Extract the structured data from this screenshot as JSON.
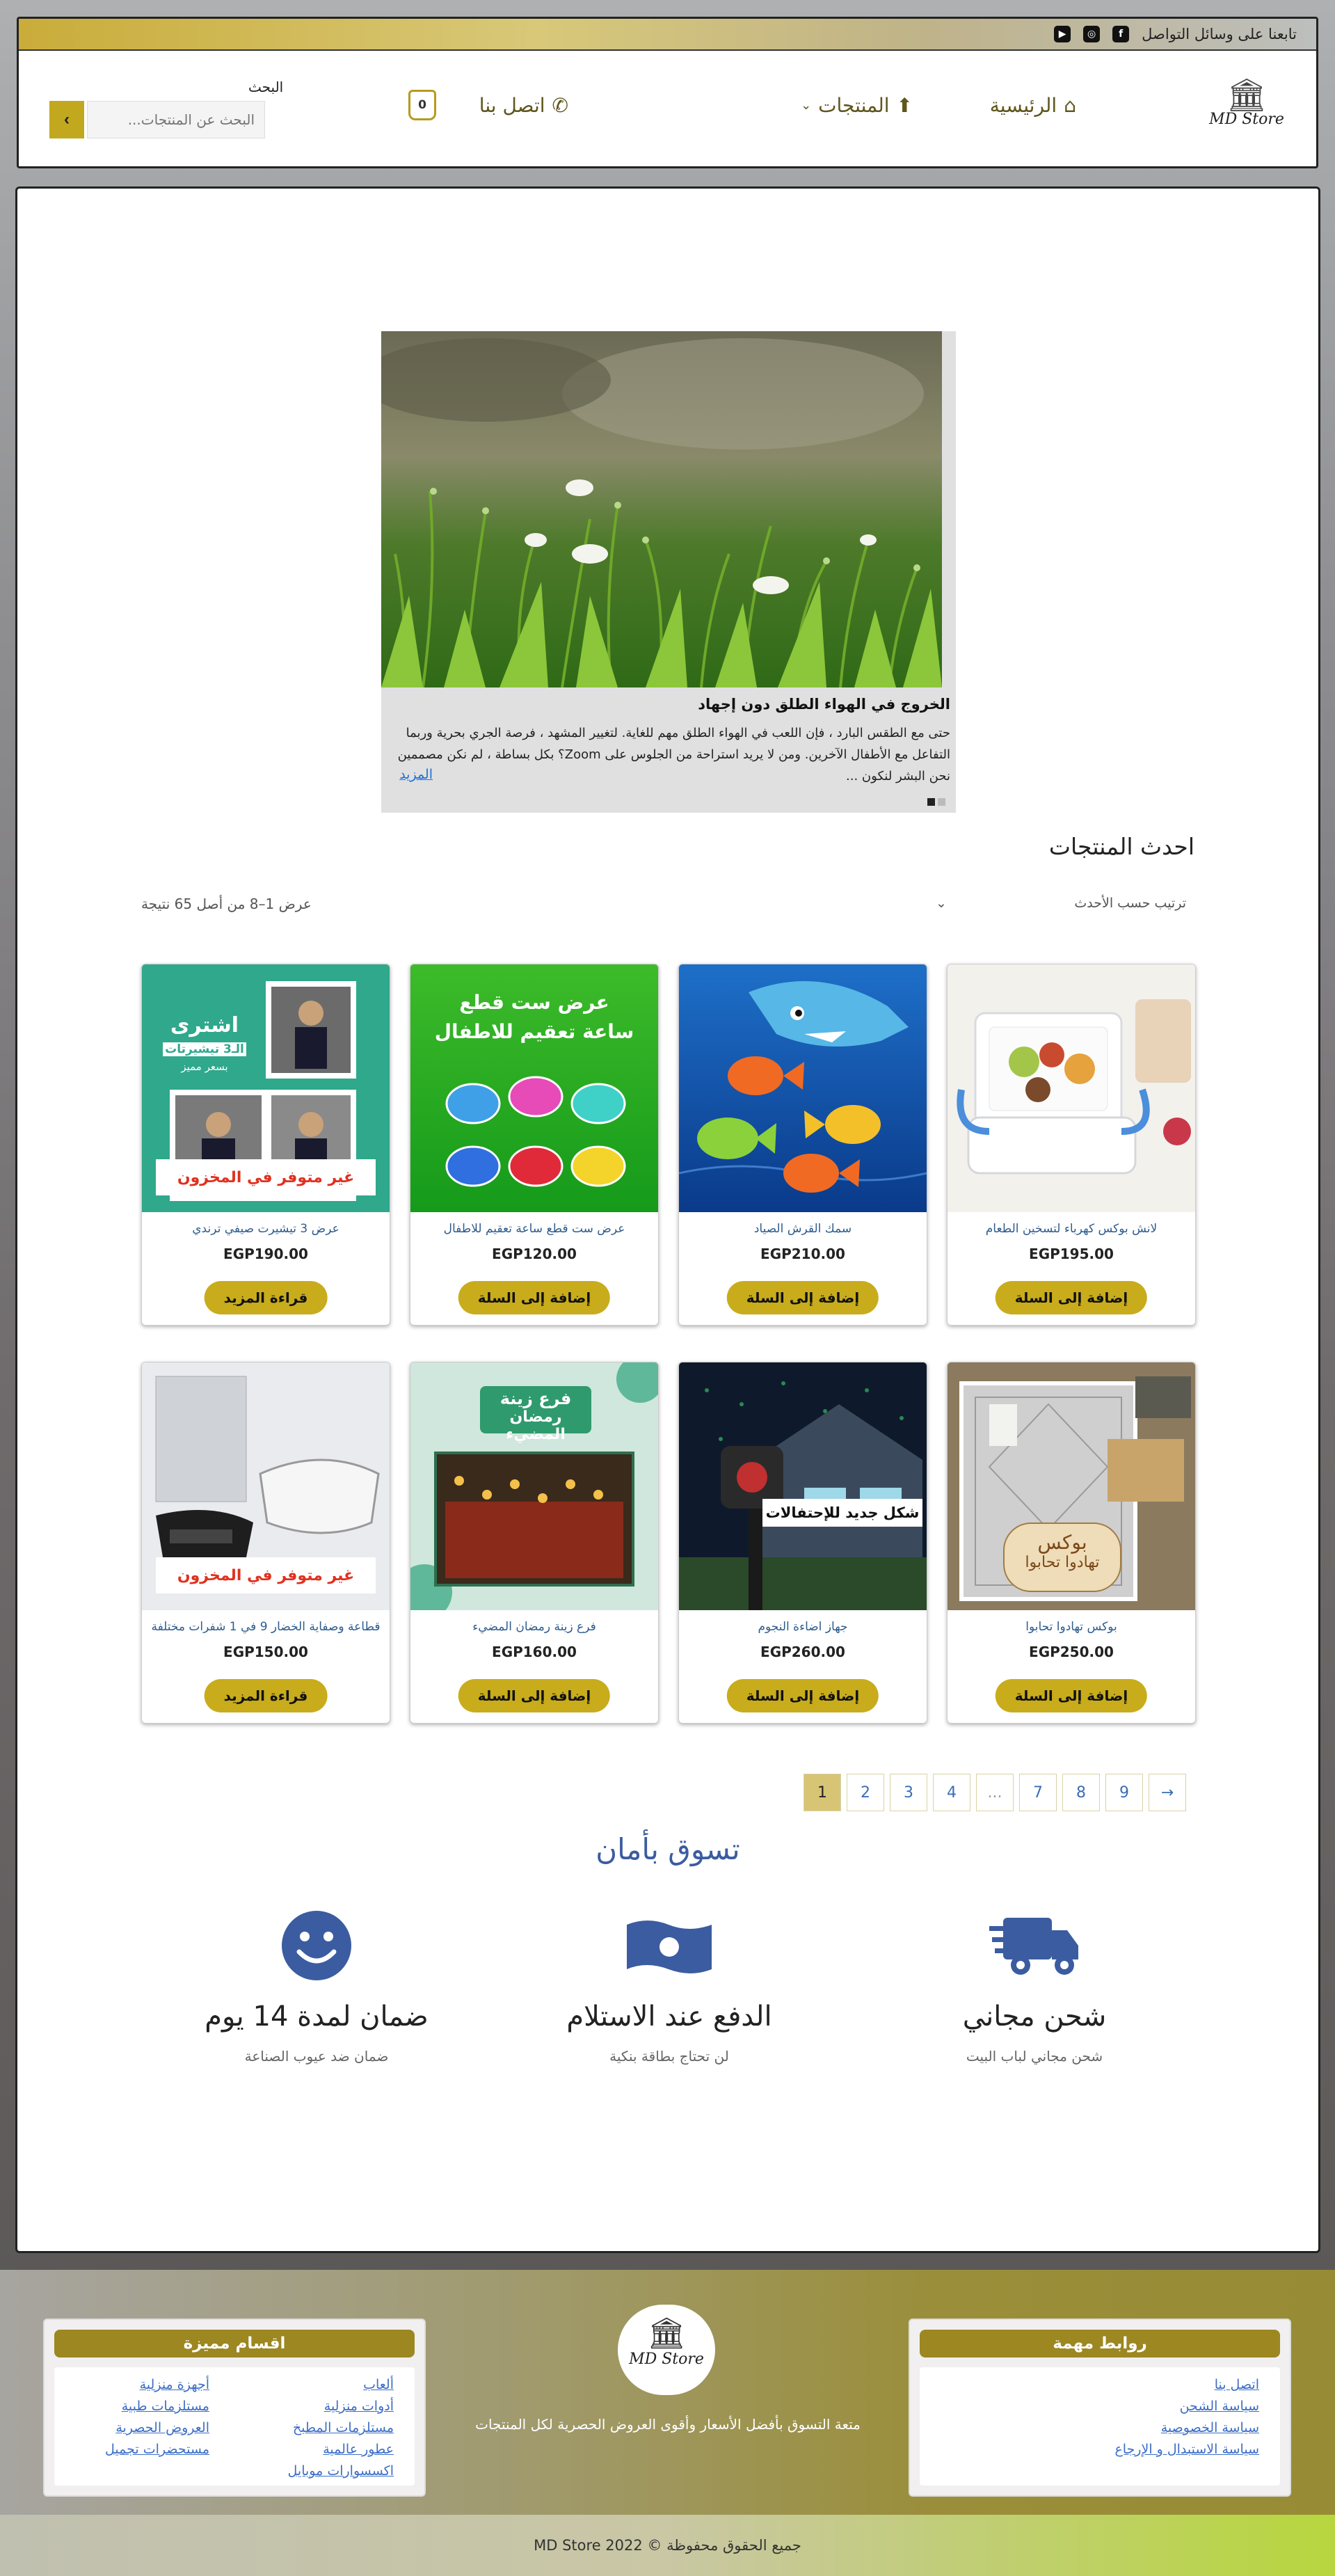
{
  "topbar": {
    "follow": "تابعنا على وسائل التواصل",
    "social": [
      {
        "icon": "facebook-icon",
        "glyph": "f"
      },
      {
        "icon": "instagram-icon",
        "glyph": "◎"
      },
      {
        "icon": "youtube-icon",
        "glyph": "▶"
      }
    ]
  },
  "header": {
    "logo_text": "MD Store",
    "nav": {
      "home": "الرئيسية",
      "products": "المنتجات",
      "contact": "اتصل بنا"
    },
    "cart_count": "0",
    "search": {
      "label": "البحث",
      "placeholder": "البحث عن المنتجات..."
    }
  },
  "slider": {
    "title": "الخروج في الهواء الطلق دون إجهاد",
    "desc": "حتى مع الطقس البارد ، فإن اللعب في الهواء الطلق مهم للغاية. لتغيير المشهد ، فرصة الجري بحرية وربما التفاعل مع الأطفال الآخرين. ومن لا يريد استراحة من الجلوس على Zoom؟ بكل بساطة ، لم نكن مصممين نحن البشر لنكون ...",
    "more": "المزيد",
    "active_slide": 1,
    "slide_count": 2
  },
  "products_section": {
    "title": "احدث المنتجات",
    "sort_label": "ترتيب حسب الأحدث",
    "result_count": "عرض 1–8 من أصل 65 نتيجة",
    "items": [
      {
        "name": "لانش بوكس كهرباء لتسخين الطعام",
        "price": "EGP195.00",
        "button": "إضافة إلى السلة"
      },
      {
        "name": "سمك القرش الصياد",
        "price": "EGP210.00",
        "button": "إضافة إلى السلة"
      },
      {
        "name": "عرض ست قطع ساعة تعقيم للاطفال",
        "price": "EGP120.00",
        "button": "إضافة إلى السلة",
        "img_text": [
          "عرض ست قطع",
          "ساعة تعقيم للاطفال"
        ]
      },
      {
        "name": "عرض 3 تيشيرت صيفي ترندي",
        "price": "EGP190.00",
        "button": "قراءة المزيد",
        "img_text": [
          "اشترى",
          "الـ3 تيشيرتات",
          "بسعر مميز"
        ],
        "badge": "غير متوفر في المخزون"
      },
      {
        "name": "بوكس تهادوا تحابوا",
        "price": "EGP250.00",
        "button": "إضافة إلى السلة",
        "img_text": [
          "بوكس",
          "تهادوا تحابوا"
        ]
      },
      {
        "name": "جهاز اضاءة النجوم",
        "price": "EGP260.00",
        "button": "إضافة إلى السلة",
        "img_text": [
          "شكل جديد للإحتفالات"
        ]
      },
      {
        "name": "فرع زينة رمضان المضيء",
        "price": "EGP160.00",
        "button": "إضافة إلى السلة",
        "img_text": [
          "فرع زينة",
          "رمضان المضيء"
        ]
      },
      {
        "name": "قطاعة وصفاية الخضار 9 في 1 شفرات مختلفة",
        "price": "EGP150.00",
        "button": "قراءة المزيد",
        "badge": "غير متوفر في المخزون"
      }
    ]
  },
  "pagination": {
    "pages": [
      "1",
      "2",
      "3",
      "4",
      "...",
      "7",
      "8",
      "9",
      "→"
    ],
    "current": "1"
  },
  "features": {
    "title": "تسوق بأمان",
    "items": [
      {
        "icon": "truck-icon",
        "title": "شحن مجاني",
        "sub": "شحن مجاني لباب البيت"
      },
      {
        "icon": "cash-icon",
        "title": "الدفع عند الاستلام",
        "sub": "لن تحتاج بطاقة بنكية"
      },
      {
        "icon": "smiley-icon",
        "title": "ضمان لمدة 14 يوم",
        "sub": "ضمان ضد عيوب الصناعة"
      }
    ]
  },
  "footer": {
    "links_title": "روابط مهمة",
    "links": [
      "اتصل بنا",
      "سياسة الشحن",
      "سياسة الخصوصية",
      "سياسة الاستبدال و الإرجاع"
    ],
    "logo_text": "MD Store",
    "tagline": "متعة التسوق بأفضل الأسعار وأقوى العروض الحصرية لكل المنتجات",
    "cats_title": "اقسام مميزة",
    "cats_col1": [
      "ألعاب",
      "أدوات منزلية",
      "مستلزمات المطبخ",
      "عطور عالمية",
      "اكسسوارات موبايل"
    ],
    "cats_col2": [
      "أجهزة منزلية",
      "مستلزمات طبية",
      "العروض الحصرية",
      "مستحضرات تجميل"
    ],
    "copyright": "جميع الحقوق محفوظة © MD Store 2022"
  }
}
